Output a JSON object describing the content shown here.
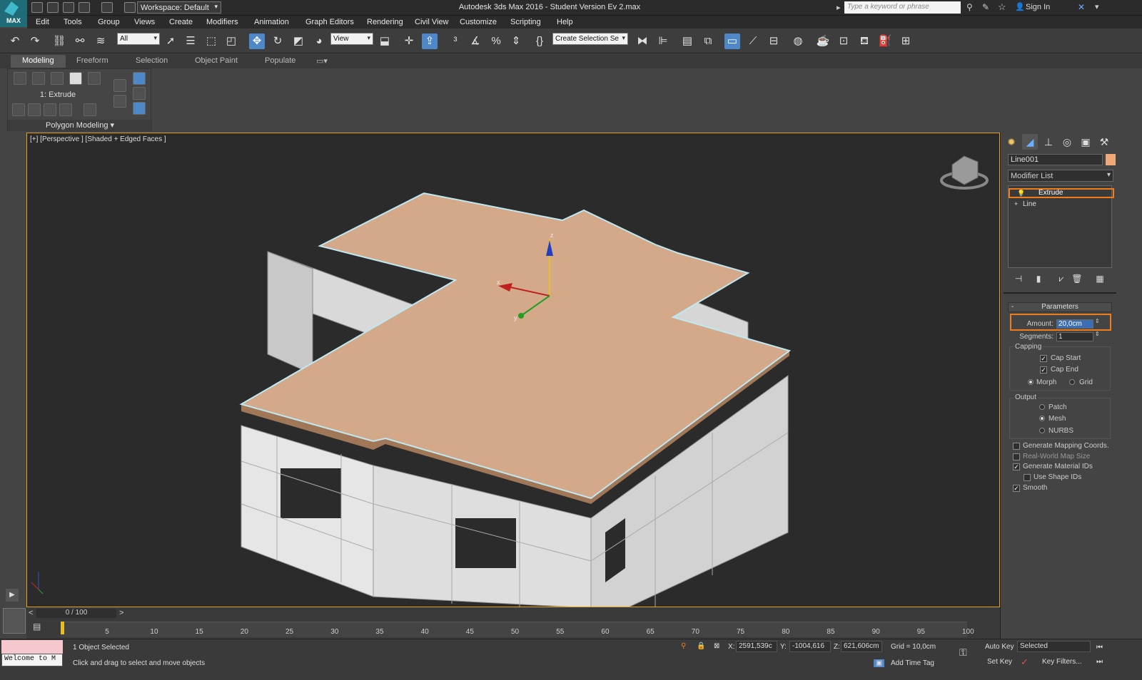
{
  "titlebar": {
    "logo_text": "MAX",
    "workspace": "Workspace: Default",
    "title": "Autodesk 3ds Max 2016 - Student Version    Ev 2.max",
    "search_placeholder": "Type a keyword or phrase",
    "signin": "Sign In"
  },
  "menu": [
    "Edit",
    "Tools",
    "Group",
    "Views",
    "Create",
    "Modifiers",
    "Animation",
    "Graph Editors",
    "Rendering",
    "Civil View",
    "Customize",
    "Scripting",
    "Help"
  ],
  "toolbar": {
    "filter_select": "All",
    "view_select": "View",
    "selection_set": "Create Selection Se"
  },
  "ribbon": {
    "tabs": [
      "Modeling",
      "Freeform",
      "Selection",
      "Object Paint",
      "Populate"
    ],
    "active_tab": "Modeling",
    "current_modifier": "1: Extrude",
    "panel_label": "Polygon Modeling"
  },
  "viewport": {
    "label": "[+] [Perspective ] [Shaded + Edged Faces ]",
    "axis_x": "x",
    "axis_y": "y",
    "axis_z": "z"
  },
  "command_panel": {
    "object_name": "Line001",
    "object_color": "#f0a878",
    "modifier_list": "Modifier List",
    "stack": [
      "Extrude",
      "Line"
    ],
    "parameters_title": "Parameters",
    "amount_label": "Amount:",
    "amount_value": "20,0cm",
    "segments_label": "Segments:",
    "segments_value": "1",
    "capping_label": "Capping",
    "cap_start": "Cap Start",
    "cap_end": "Cap End",
    "morph": "Morph",
    "grid": "Grid",
    "output_label": "Output",
    "patch": "Patch",
    "mesh": "Mesh",
    "nurbs": "NURBS",
    "gen_mapping": "Generate Mapping Coords.",
    "real_world": "Real-World Map Size",
    "gen_material": "Generate Material IDs",
    "use_shape": "Use Shape IDs",
    "smooth": "Smooth"
  },
  "timeline": {
    "frame": "0 / 100",
    "ticks": [
      "5",
      "10",
      "15",
      "20",
      "25",
      "30",
      "35",
      "40",
      "45",
      "50",
      "55",
      "60",
      "65",
      "70",
      "75",
      "80",
      "85",
      "90",
      "95",
      "100"
    ]
  },
  "status": {
    "welcome": "Welcome to M",
    "selected_text": "1 Object Selected",
    "prompt": "Click and drag to select and move objects",
    "x_label": "X:",
    "x_value": "2591,539c",
    "y_label": "Y:",
    "y_value": "-1004,616",
    "z_label": "Z:",
    "z_value": "621,606cm",
    "grid": "Grid = 10,0cm",
    "add_time_tag": "Add Time Tag",
    "auto_key": "Auto Key",
    "set_key": "Set Key",
    "selected_dd": "Selected",
    "key_filters": "Key Filters..."
  },
  "colors": {
    "accent": "#f07d1a",
    "roof": "#d4a98a",
    "viewport_border": "#e0a520"
  }
}
